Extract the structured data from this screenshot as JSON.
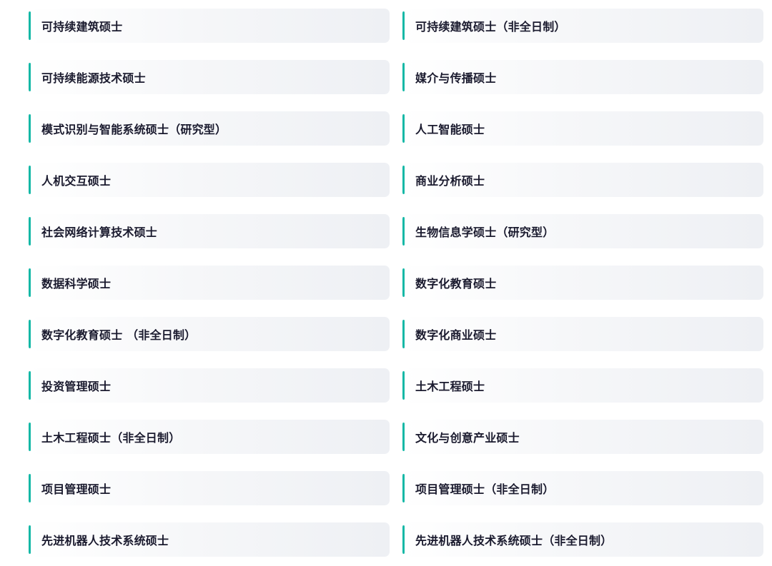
{
  "accent_color": "#14b8a6",
  "programs": [
    {
      "label": "可持续建筑硕士"
    },
    {
      "label": "可持续建筑硕士（非全日制）"
    },
    {
      "label": "可持续能源技术硕士"
    },
    {
      "label": "媒介与传播硕士"
    },
    {
      "label": "模式识别与智能系统硕士（研究型）"
    },
    {
      "label": "人工智能硕士"
    },
    {
      "label": "人机交互硕士"
    },
    {
      "label": "商业分析硕士"
    },
    {
      "label": "社会网络计算技术硕士"
    },
    {
      "label": "生物信息学硕士（研究型）"
    },
    {
      "label": "数据科学硕士"
    },
    {
      "label": "数字化教育硕士"
    },
    {
      "label": "数字化教育硕士 （非全日制）"
    },
    {
      "label": "数字化商业硕士"
    },
    {
      "label": "投资管理硕士"
    },
    {
      "label": "土木工程硕士"
    },
    {
      "label": "土木工程硕士（非全日制）"
    },
    {
      "label": "文化与创意产业硕士"
    },
    {
      "label": "项目管理硕士"
    },
    {
      "label": "项目管理硕士（非全日制）"
    },
    {
      "label": "先进机器人技术系统硕士"
    },
    {
      "label": "先进机器人技术系统硕士（非全日制）"
    }
  ]
}
